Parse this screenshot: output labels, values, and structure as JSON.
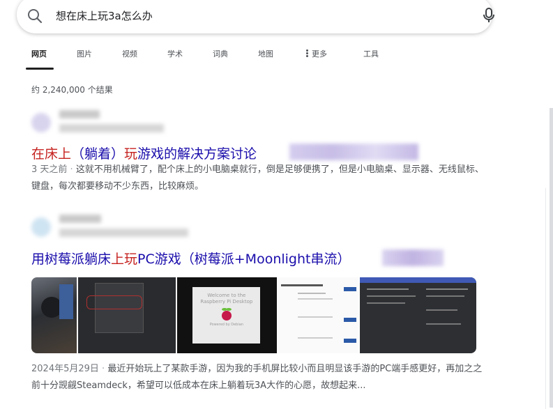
{
  "search": {
    "query": "想在床上玩3a怎么办",
    "icon": "search-icon",
    "mic_icon": "microphone-icon"
  },
  "tabs": [
    {
      "label": "网页",
      "active": true
    },
    {
      "label": "图片"
    },
    {
      "label": "视频"
    },
    {
      "label": "学术"
    },
    {
      "label": "词典"
    },
    {
      "label": "地图"
    },
    {
      "label": "更多"
    },
    {
      "label": "工具"
    }
  ],
  "stats": "约 2,240,000 个结果",
  "results": [
    {
      "title_parts": [
        "在床上",
        "（躺着）",
        "玩",
        "游戏的解决方案讨论"
      ],
      "title_highlight": [
        true,
        false,
        true,
        false
      ],
      "date": "3 天之前",
      "snippet": "这就不用机械臂了，配个床上的小电脑桌就行，倒是足够便携了，但是小电脑桌、显示器、无线鼠标、键盘，每次都要移动不少东西，比较麻烦。"
    },
    {
      "title_parts": [
        "用树莓派躺床",
        "上玩",
        "PC游戏（树莓派+Moonlight串流）"
      ],
      "title_highlight": [
        false,
        true,
        false
      ],
      "date": "2024年5月29日",
      "snippet": "最近开始玩上了某款手游，因为我的手机屏比较小而且明显该手游的PC端手感更好，再加之之前十分觊觎Steamdeck，希望可以低成本在床上躺着玩3A大作的心愿，故想起来...",
      "thumbnail_text": [
        "Welcome to the",
        "Raspberry Pi Desktop",
        "Powered by Debian"
      ]
    }
  ],
  "colors": {
    "link": "#1a0dab",
    "highlight": "#c5221f",
    "text_secondary": "#4d5156"
  }
}
